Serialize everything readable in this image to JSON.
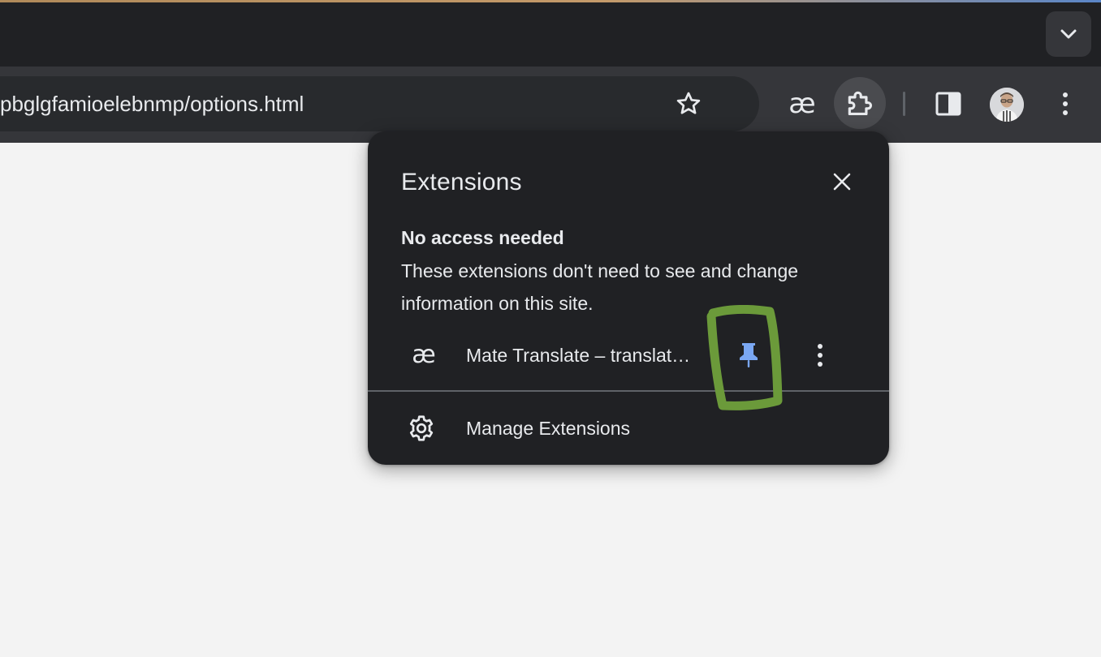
{
  "browser": {
    "address_bar": {
      "url_text": "pbglgfamioelebnmp/options.html"
    },
    "toolbar_icons": {
      "tab_search": "chevron-down-icon",
      "bookmark": "star-icon",
      "pinned_extension": "ae-icon",
      "extensions": "puzzle-piece-icon",
      "side_panel": "side-panel-icon",
      "profile": "avatar",
      "menu": "three-dots-vertical-icon"
    },
    "pinned_extension_glyph": "æ"
  },
  "extensions_popup": {
    "title": "Extensions",
    "close_icon": "close-icon",
    "section": {
      "heading": "No access needed",
      "description": "These extensions don't need to see and change information on this site."
    },
    "extensions": [
      {
        "name": "Mate Translate – translat…",
        "icon_glyph": "æ",
        "pinned": true,
        "pin_icon": "pin-icon",
        "more_icon": "three-dots-vertical-icon"
      }
    ],
    "manage": {
      "label": "Manage Extensions",
      "icon": "gear-icon"
    }
  },
  "colors": {
    "tab_strip": "#202124",
    "toolbar": "#35363a",
    "omnibox": "#282a2d",
    "popup_bg": "#202124",
    "text": "#e8eaed",
    "pin_accent": "#7aa7f2",
    "annotation_green": "#6b9a3a",
    "page_bg": "#f3f3f3"
  }
}
